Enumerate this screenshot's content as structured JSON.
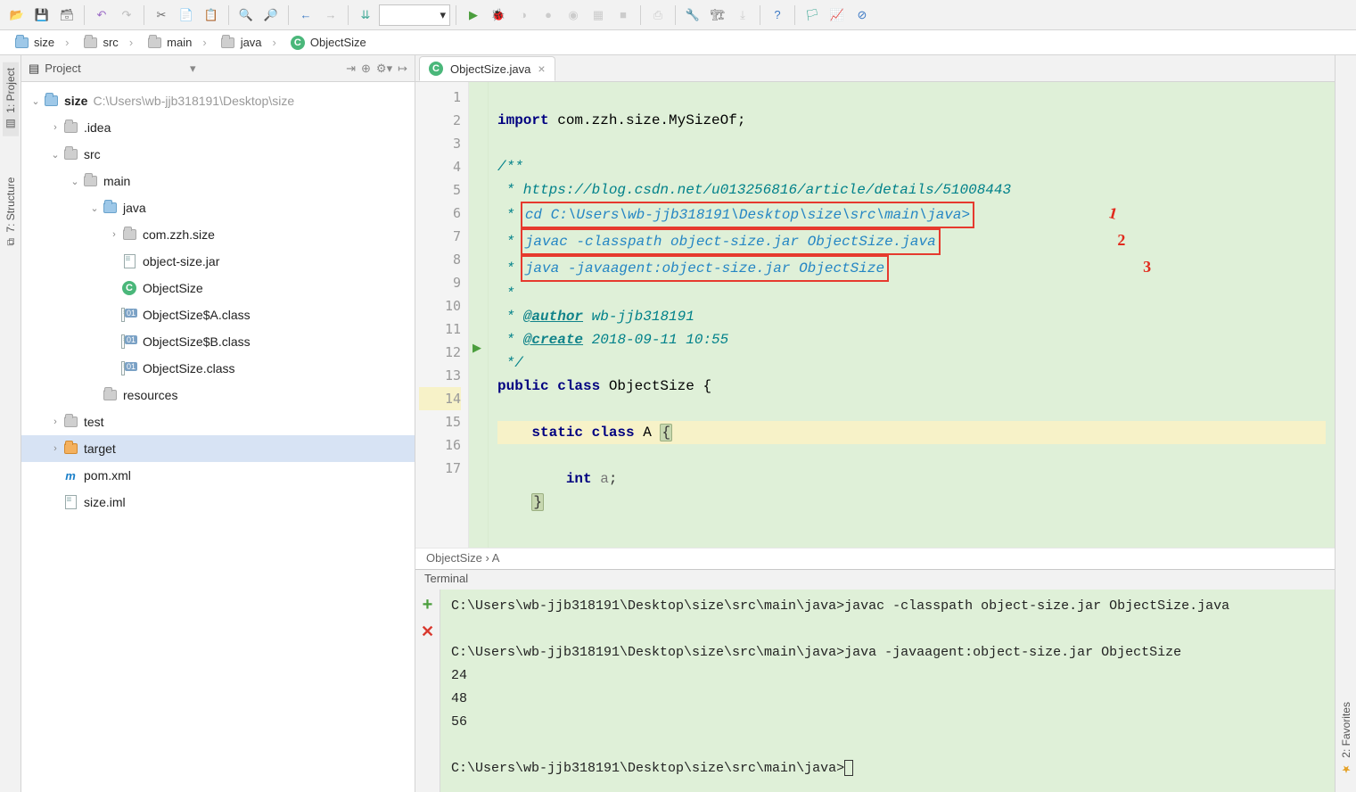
{
  "toolbar": {
    "icons": [
      "open",
      "save",
      "save-all",
      "sep",
      "undo",
      "redo",
      "sep",
      "cut",
      "copy",
      "paste",
      "sep",
      "find",
      "replace",
      "sep",
      "back",
      "forward",
      "sep",
      "binary",
      "combo",
      "sep",
      "run",
      "debug",
      "stop1",
      "stop2",
      "coverage",
      "profile",
      "stop3",
      "sep",
      "attach",
      "sep",
      "settings",
      "project-structure",
      "export",
      "sep",
      "help",
      "sep",
      "marker",
      "monitor",
      "block"
    ]
  },
  "breadcrumb": [
    {
      "icon": "folder-blue",
      "label": "size"
    },
    {
      "icon": "folder-grey",
      "label": "src"
    },
    {
      "icon": "folder-grey",
      "label": "main"
    },
    {
      "icon": "folder-grey",
      "label": "java"
    },
    {
      "icon": "class",
      "label": "ObjectSize"
    }
  ],
  "leftTabs": [
    {
      "label": "1: Project",
      "selected": true
    },
    {
      "label": "7: Structure",
      "selected": false
    }
  ],
  "leftBottomTabs": [
    {
      "label": "2: Favorites"
    }
  ],
  "project": {
    "title": "Project",
    "root": {
      "label": "size",
      "suffix": "C:\\Users\\wb-jjb318191\\Desktop\\size",
      "icon": "folder-blue",
      "bold": true
    },
    "tree": [
      {
        "depth": 1,
        "exp": "›",
        "icon": "folder-grey",
        "label": ".idea"
      },
      {
        "depth": 1,
        "exp": "⌄",
        "icon": "folder-grey",
        "label": "src"
      },
      {
        "depth": 2,
        "exp": "⌄",
        "icon": "folder-grey",
        "label": "main"
      },
      {
        "depth": 3,
        "exp": "⌄",
        "icon": "folder-blue",
        "label": "java"
      },
      {
        "depth": 4,
        "exp": "›",
        "icon": "folder-grey",
        "label": "com.zzh.size"
      },
      {
        "depth": 4,
        "exp": "",
        "icon": "file",
        "label": "object-size.jar"
      },
      {
        "depth": 4,
        "exp": "",
        "icon": "class",
        "label": "ObjectSize"
      },
      {
        "depth": 4,
        "exp": "",
        "icon": "file01",
        "label": "ObjectSize$A.class"
      },
      {
        "depth": 4,
        "exp": "",
        "icon": "file01",
        "label": "ObjectSize$B.class"
      },
      {
        "depth": 4,
        "exp": "",
        "icon": "file01",
        "label": "ObjectSize.class"
      },
      {
        "depth": 3,
        "exp": "",
        "icon": "folder-grey",
        "label": "resources"
      },
      {
        "depth": 1,
        "exp": "›",
        "icon": "folder-grey",
        "label": "test"
      },
      {
        "depth": 1,
        "exp": "›",
        "icon": "folder-orange",
        "label": "target",
        "selected": true
      },
      {
        "depth": 1,
        "exp": "",
        "icon": "xml",
        "label": "pom.xml"
      },
      {
        "depth": 1,
        "exp": "",
        "icon": "file",
        "label": "size.iml"
      }
    ]
  },
  "editor": {
    "tab": {
      "label": "ObjectSize.java"
    },
    "lines": [
      "1",
      "2",
      "3",
      "4",
      "5",
      "6",
      "7",
      "8",
      "9",
      "10",
      "11",
      "12",
      "13",
      "14",
      "15",
      "16",
      "17"
    ],
    "code": {
      "l1a": "import",
      "l1b": " com.zzh.size.MySizeOf;",
      "l3": "/**",
      "l4": " * https://blog.csdn.net/u013256816/article/details/51008443",
      "l5": " * ",
      "l5b": "cd C:\\Users\\wb-jjb318191\\Desktop\\size\\src\\main\\java>",
      "l6": " * ",
      "l6b": "javac -classpath object-size.jar ObjectSize.java",
      "l7": " * ",
      "l7b": "java -javaagent:object-size.jar ObjectSize",
      "l8": " *",
      "l9a": " * ",
      "l9b": "@author",
      "l9c": " wb-jjb318191",
      "l10a": " * ",
      "l10b": "@create",
      "l10c": " 2018-09-11 10:55",
      "l11": " */",
      "l12a": "public class",
      "l12b": " ObjectSize {",
      "l14a": "    static class",
      "l14b": " A ",
      "l14c": "{",
      "l16a": "        int ",
      "l16b": "a",
      "l17a": "    ",
      "l17b": "}"
    },
    "annotations": {
      "a1": "1",
      "a2": "2",
      "a3": "3"
    },
    "crumb": "ObjectSize › A"
  },
  "terminal": {
    "title": "Terminal",
    "lines": [
      "C:\\Users\\wb-jjb318191\\Desktop\\size\\src\\main\\java>javac -classpath object-size.jar ObjectSize.java",
      "",
      "C:\\Users\\wb-jjb318191\\Desktop\\size\\src\\main\\java>java -javaagent:object-size.jar ObjectSize",
      "24",
      "48",
      "56",
      "",
      "C:\\Users\\wb-jjb318191\\Desktop\\size\\src\\main\\java>"
    ]
  }
}
